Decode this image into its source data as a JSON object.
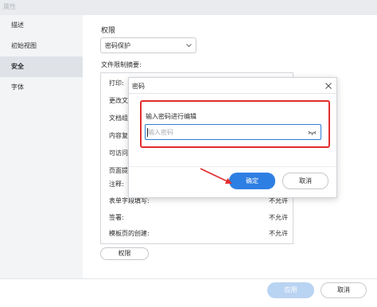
{
  "window": {
    "title": "属性"
  },
  "sidebar": {
    "items": [
      {
        "label": "描述",
        "active": false
      },
      {
        "label": "初始视图",
        "active": false
      },
      {
        "label": "安全",
        "active": true
      },
      {
        "label": "字体",
        "active": false
      }
    ]
  },
  "main": {
    "section_title": "权限",
    "security_select": {
      "value": "密码保护"
    },
    "summary_label": "文件限制摘要:",
    "permissions": [
      {
        "key": "打印:",
        "value": ""
      },
      {
        "key": "更改文",
        "value": ""
      },
      {
        "key": "文档组",
        "value": ""
      },
      {
        "key": "内容复",
        "value": ""
      },
      {
        "key": "可访问",
        "value": ""
      },
      {
        "key": "页面提",
        "value": ""
      },
      {
        "key": "注释:",
        "value": ""
      },
      {
        "key": "表单字段填写:",
        "value": "不允许"
      },
      {
        "key": "签署:",
        "value": "不允许"
      },
      {
        "key": "模板页的创建:",
        "value": "不允许"
      }
    ],
    "permissions_button": "权限"
  },
  "footer": {
    "apply_label": "应用",
    "cancel_label": "取消"
  },
  "modal": {
    "title": "密码",
    "prompt": "输入密码进行编辑",
    "input_placeholder": "输入密码",
    "ok_label": "确定",
    "cancel_label": "取消"
  },
  "colors": {
    "accent": "#2e7fe3",
    "annotation": "#e22d2d",
    "apply_disabled": "#b9d3f2"
  }
}
